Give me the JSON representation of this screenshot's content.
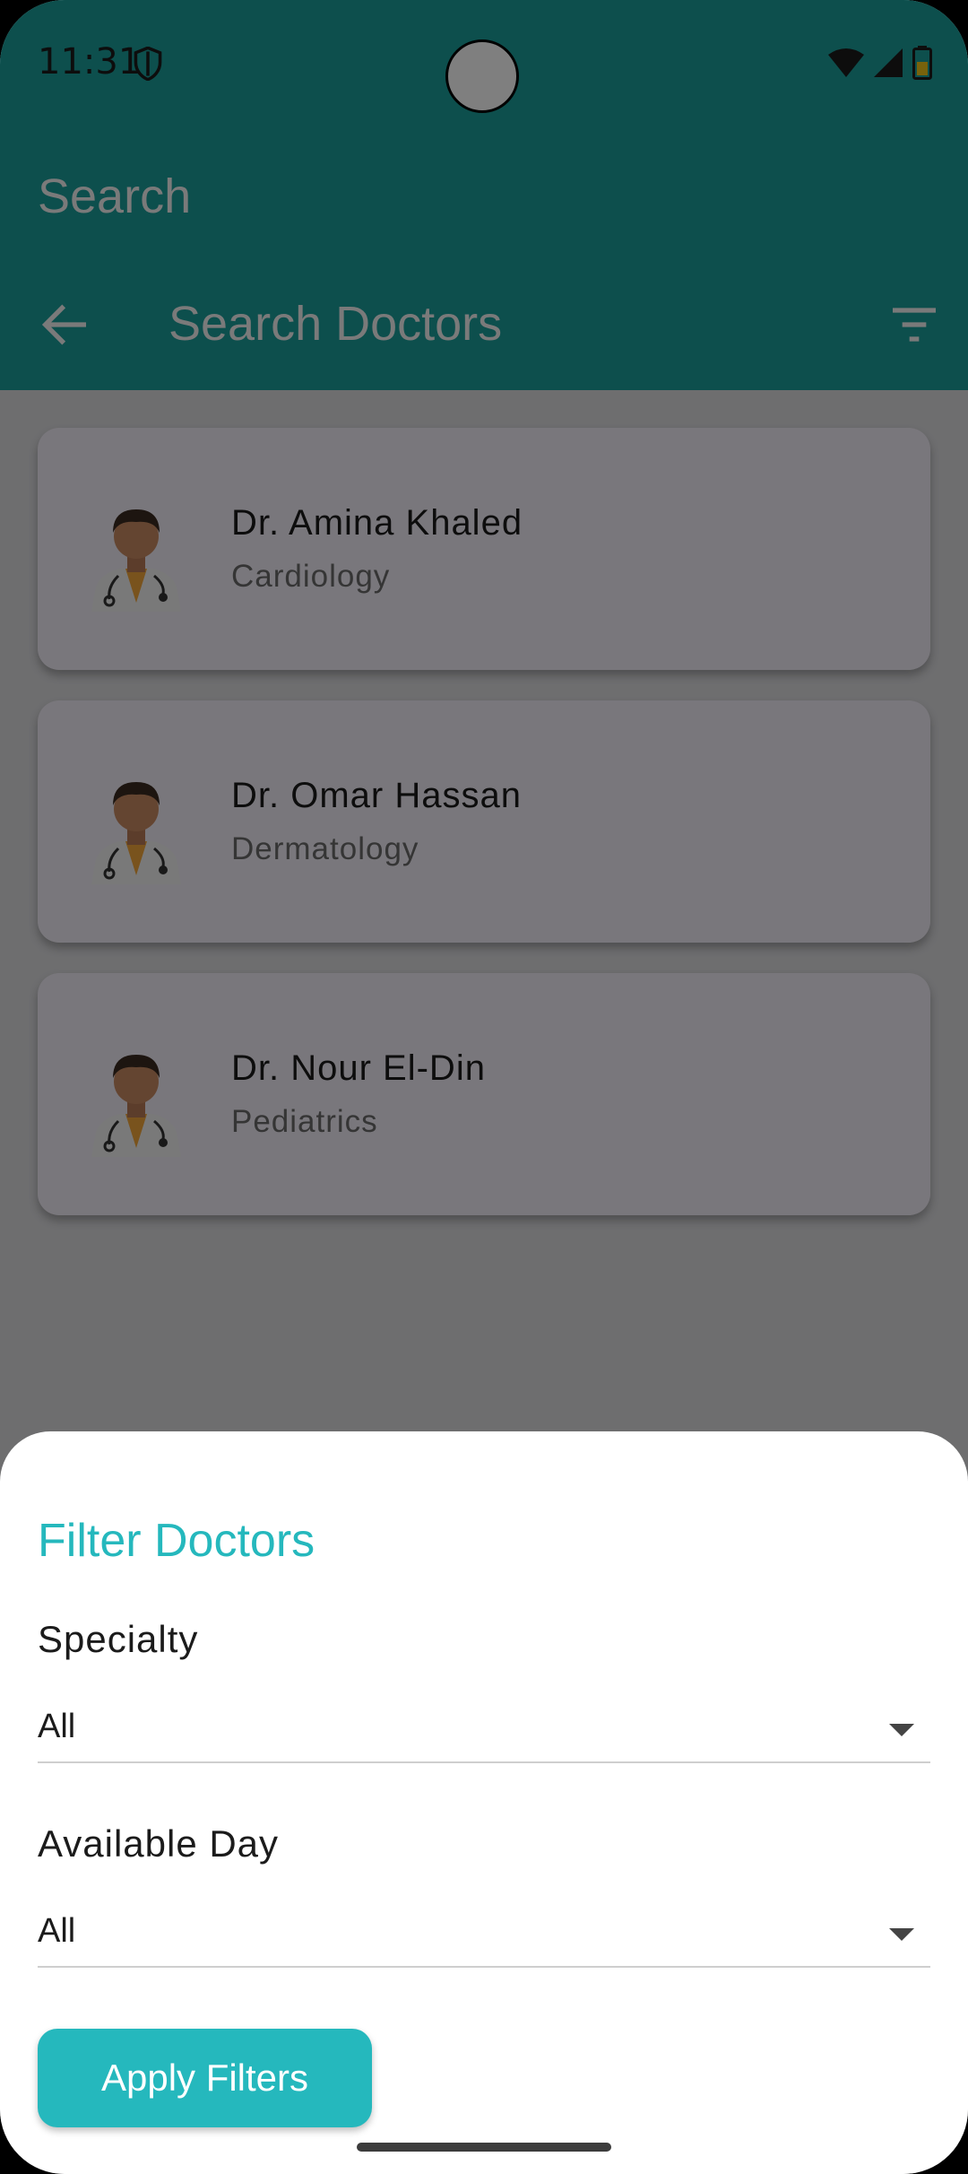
{
  "status_bar": {
    "time": "11:31"
  },
  "top_bar": {
    "title": "Search"
  },
  "app_bar": {
    "title": "Search Doctors"
  },
  "doctors": [
    {
      "name": "Dr. Amina Khaled",
      "specialty": "Cardiology"
    },
    {
      "name": "Dr. Omar Hassan",
      "specialty": "Dermatology"
    },
    {
      "name": "Dr. Nour El-Din",
      "specialty": "Pediatrics"
    }
  ],
  "filter_sheet": {
    "title": "Filter Doctors",
    "specialty_label": "Specialty",
    "specialty_value": "All",
    "day_label": "Available Day",
    "day_value": "All",
    "apply_label": "Apply Filters"
  },
  "colors": {
    "primary": "#1a9e9a",
    "accent": "#25b8bd"
  },
  "icons": {
    "back": "arrow-back-icon",
    "filter": "filter-list-icon",
    "avatar": "doctor-avatar-icon"
  }
}
